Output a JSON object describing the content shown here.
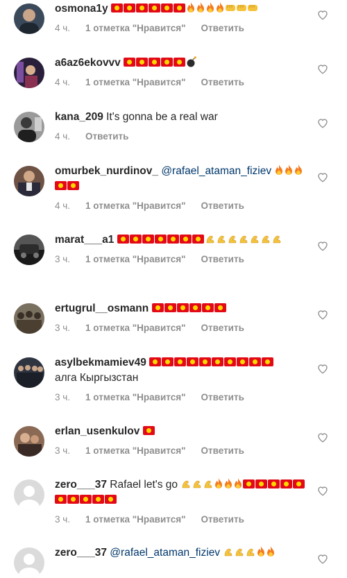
{
  "comments": [
    {
      "username": "osmona1y",
      "mention": "",
      "text": "",
      "emoji": "🇰🇬🇰🇬🇰🇬🇰🇬🇰🇬🇰🇬🔥🔥🔥🔥👊👊👊",
      "time": "4 ч.",
      "likes": "1 отметка \"Нравится\"",
      "reply": "Ответить",
      "avatar_color": "#3b4a5a"
    },
    {
      "username": "a6az6ekovvv",
      "mention": "",
      "text": "",
      "emoji": "🇰🇬🇰🇬🇰🇬🇰🇬🇰🇬💣",
      "time": "4 ч.",
      "likes": "1 отметка \"Нравится\"",
      "reply": "Ответить",
      "avatar_color": "#5a4a6b"
    },
    {
      "username": "kana_209",
      "mention": "",
      "text": "It's gonna be a real war",
      "emoji": "",
      "time": "4 ч.",
      "likes": "",
      "reply": "Ответить",
      "avatar_color": "#4a4a4a"
    },
    {
      "username": "omurbek_nurdinov_",
      "mention": "@rafael_ataman_fiziev",
      "text": "",
      "emoji": "🔥🔥🔥🇰🇬🇰🇬",
      "time": "4 ч.",
      "likes": "1 отметка \"Нравится\"",
      "reply": "Ответить",
      "avatar_color": "#6b4a3a"
    },
    {
      "username": "marat___a1",
      "mention": "",
      "text": "",
      "emoji": "🇰🇬🇰🇬🇰🇬🇰🇬🇰🇬🇰🇬🇰🇬💪💪💪💪💪💪💪",
      "time": "3 ч.",
      "likes": "1 отметка \"Нравится\"",
      "reply": "Ответить",
      "avatar_color": "#2f2f2f"
    },
    {
      "username": "ertugrul__osmann",
      "mention": "",
      "text": "",
      "emoji": "🇰🇬🇰🇬🇰🇬🇰🇬🇰🇬🇰🇬",
      "time": "3 ч.",
      "likes": "1 отметка \"Нравится\"",
      "reply": "Ответить",
      "avatar_color": "#5a5040"
    },
    {
      "username": "asylbekmamiev49",
      "mention": "",
      "text": "алга Кыргызстан",
      "emoji": "🇰🇬🇰🇬🇰🇬🇰🇬🇰🇬🇰🇬🇰🇬🇰🇬🇰🇬🇰🇬",
      "time": "3 ч.",
      "likes": "1 отметка \"Нравится\"",
      "reply": "Ответить",
      "avatar_color": "#3a3f4a"
    },
    {
      "username": "erlan_usenkulov",
      "mention": "",
      "text": "",
      "emoji": "🇰🇬",
      "time": "3 ч.",
      "likes": "1 отметка \"Нравится\"",
      "reply": "Ответить",
      "avatar_color": "#7a5a4a"
    },
    {
      "username": "zero___37",
      "mention": "",
      "text": "Rafael let's go",
      "emoji": "💪💪💪🔥🔥🔥🇰🇬🇰🇬🇰🇬🇰🇬🇰🇬🇰🇬🇰🇬🇰🇬🇰🇬🇰🇬",
      "time": "3 ч.",
      "likes": "1 отметка \"Нравится\"",
      "reply": "Ответить",
      "avatar_color": "#dbdbdb"
    },
    {
      "username": "zero___37",
      "mention": "@rafael_ataman_fiziev",
      "text": "",
      "emoji": "💪💪💪🔥🔥",
      "time": "",
      "likes": "",
      "reply": "",
      "avatar_color": "#dbdbdb"
    }
  ]
}
